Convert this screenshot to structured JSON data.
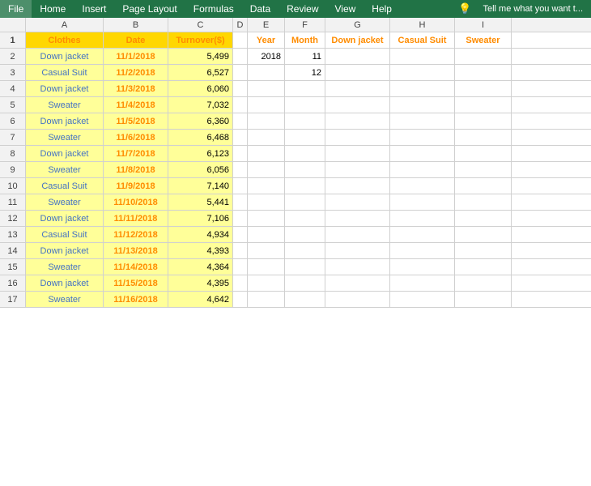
{
  "menu": {
    "items": [
      "File",
      "Home",
      "Insert",
      "Page Layout",
      "Formulas",
      "Data",
      "Review",
      "View",
      "Help"
    ],
    "tell_me": "Tell me what you want t..."
  },
  "columns": {
    "letters": [
      "A",
      "B",
      "C",
      "D",
      "E",
      "F",
      "G",
      "H",
      "I"
    ],
    "headers": {
      "A": "Clothes",
      "B": "Date",
      "C": "Turnover($)",
      "D": "",
      "E": "Year",
      "F": "Month",
      "G": "Down jacket",
      "H": "Casual Suit",
      "I": "Sweater"
    }
  },
  "data": [
    {
      "row": 2,
      "clothes": "Down jacket",
      "date": "11/1/2018",
      "turnover": "5,499",
      "year": "2018",
      "month": "11"
    },
    {
      "row": 3,
      "clothes": "Casual Suit",
      "date": "11/2/2018",
      "turnover": "6,527",
      "year": "",
      "month": "12"
    },
    {
      "row": 4,
      "clothes": "Down jacket",
      "date": "11/3/2018",
      "turnover": "6,060",
      "year": "",
      "month": ""
    },
    {
      "row": 5,
      "clothes": "Sweater",
      "date": "11/4/2018",
      "turnover": "7,032",
      "year": "",
      "month": ""
    },
    {
      "row": 6,
      "clothes": "Down jacket",
      "date": "11/5/2018",
      "turnover": "6,360",
      "year": "",
      "month": ""
    },
    {
      "row": 7,
      "clothes": "Sweater",
      "date": "11/6/2018",
      "turnover": "6,468",
      "year": "",
      "month": ""
    },
    {
      "row": 8,
      "clothes": "Down jacket",
      "date": "11/7/2018",
      "turnover": "6,123",
      "year": "",
      "month": ""
    },
    {
      "row": 9,
      "clothes": "Sweater",
      "date": "11/8/2018",
      "turnover": "6,056",
      "year": "",
      "month": ""
    },
    {
      "row": 10,
      "clothes": "Casual Suit",
      "date": "11/9/2018",
      "turnover": "7,140",
      "year": "",
      "month": ""
    },
    {
      "row": 11,
      "clothes": "Sweater",
      "date": "11/10/2018",
      "turnover": "5,441",
      "year": "",
      "month": ""
    },
    {
      "row": 12,
      "clothes": "Down jacket",
      "date": "11/11/2018",
      "turnover": "7,106",
      "year": "",
      "month": ""
    },
    {
      "row": 13,
      "clothes": "Casual Suit",
      "date": "11/12/2018",
      "turnover": "4,934",
      "year": "",
      "month": ""
    },
    {
      "row": 14,
      "clothes": "Down jacket",
      "date": "11/13/2018",
      "turnover": "4,393",
      "year": "",
      "month": ""
    },
    {
      "row": 15,
      "clothes": "Sweater",
      "date": "11/14/2018",
      "turnover": "4,364",
      "year": "",
      "month": ""
    },
    {
      "row": 16,
      "clothes": "Down jacket",
      "date": "11/15/2018",
      "turnover": "4,395",
      "year": "",
      "month": ""
    },
    {
      "row": 17,
      "clothes": "Sweater",
      "date": "11/16/2018",
      "turnover": "4,642",
      "year": "",
      "month": ""
    }
  ]
}
